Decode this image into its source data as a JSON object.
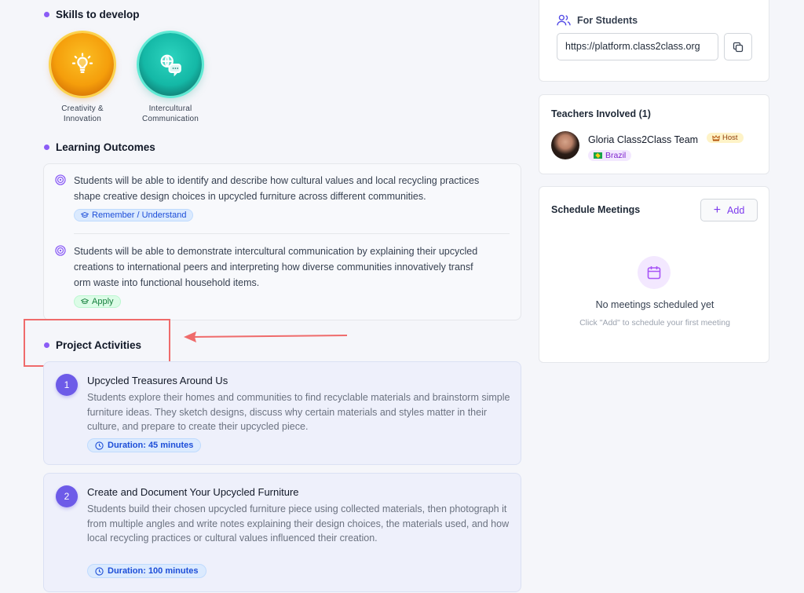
{
  "skills": {
    "heading": "Skills to develop",
    "items": [
      {
        "line1": "Creativity &",
        "line2": "Innovation",
        "icon": "lightbulb-icon",
        "color": "#f59e0b"
      },
      {
        "line1": "Intercultural",
        "line2": "Communication",
        "icon": "chat-bubbles-icon",
        "color": "#14b8a6"
      }
    ]
  },
  "outcomes": {
    "heading": "Learning Outcomes",
    "items": [
      {
        "line1": "Students will be able to identify and describe how cultural values and local recycling practices",
        "line2": "shape creative design choices in upcycled furniture across different communities.",
        "tag": "Remember / Understand"
      },
      {
        "line1": "Students will be able to demonstrate intercultural communication by explaining their upcycled",
        "line2": "creations to international peers and interpreting how diverse communities innovatively transf",
        "line3": "orm waste into functional household items.",
        "tag": "Apply"
      }
    ]
  },
  "activities": {
    "heading": "Project Activities",
    "items": [
      {
        "num": "1",
        "title": "Upcycled Treasures Around Us",
        "desc": "Students explore their homes and communities to find recyclable materials and brainstorm simple furniture ideas. They sketch designs, discuss why certain materials and styles matter in their culture, and prepare to create their upcycled piece.",
        "duration": "Duration: 45 minutes"
      },
      {
        "num": "2",
        "title": "Create and Document Your Upcycled Furniture",
        "desc": "Students build their chosen upcycled furniture piece using collected materials, then photograph it from multiple angles and write notes explaining their design choices, the materials used, and how local recycling practices or cultural values influenced their creation.",
        "duration": "Duration: 100 minutes"
      }
    ]
  },
  "students": {
    "title": "For Students",
    "url": "https://platform.class2class.org"
  },
  "teachers": {
    "title": "Teachers Involved (1)",
    "name": "Gloria Class2Class Team",
    "role": "Host",
    "country": "Brazil"
  },
  "meetings": {
    "title": "Schedule Meetings",
    "add_label": "Add",
    "empty_title": "No meetings scheduled yet",
    "empty_sub": "Click \"Add\" to schedule your first meeting"
  },
  "colors": {
    "accent": "#8b5cf6",
    "annotation": "#ef6b6b"
  }
}
